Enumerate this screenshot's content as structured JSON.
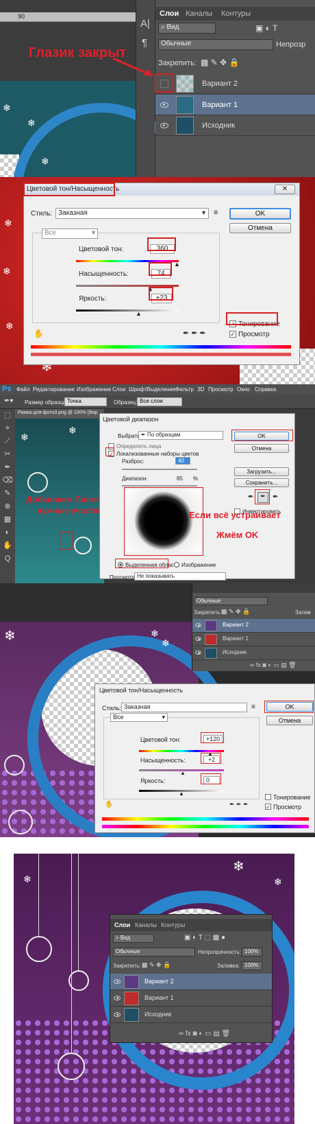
{
  "p1": {
    "ruler_num": "90",
    "tabs": [
      "Слои",
      "Каналы",
      "Контуры"
    ],
    "filter": "Вид",
    "blend": "Обычные",
    "opacity_label": "Непрозр",
    "lock_label": "Закрепить:",
    "layers": [
      "Вариант 2",
      "Вариант 1",
      "Исходник"
    ],
    "annotation": "Глазик закрыт"
  },
  "p2": {
    "title": "Цветовой тон/Насыщенность",
    "style_label": "Стиль:",
    "style_value": "Заказная",
    "channel": "Все",
    "hue_label": "Цветовой тон:",
    "hue_value": "360",
    "sat_label": "Насыщенность:",
    "sat_value": "74",
    "light_label": "Яркость:",
    "light_value": "+23",
    "ok": "OK",
    "cancel": "Отмена",
    "colorize": "Тонирование",
    "preview": "Просмотр"
  },
  "p3": {
    "menu": [
      "Файл",
      "Редактирование",
      "Изображение",
      "Слои",
      "Шрифт",
      "Выделение",
      "Фильтр",
      "3D",
      "Просмотр",
      "Окно",
      "Справка"
    ],
    "opt_size_label": "Размер образца:",
    "opt_size_value": "Точка",
    "opt_sample_label": "Образец:",
    "opt_sample_value": "Все слои",
    "doc_tab": "Рамка-для-фото3.png @ 100% (Вар",
    "dialog_title": "Цветовой диапазон",
    "select_label": "Выбрать:",
    "select_value": "По образцам",
    "faces": "Определять лица",
    "localized": "Локализованные наборы цветов",
    "fuzz_label": "Разброс:",
    "fuzz_value": "40",
    "range_label": "Диапазон:",
    "range_value": "85",
    "range_unit": "%",
    "radio_selection": "Выделенная область",
    "radio_image": "Изображение",
    "preview_label": "Просмотр:",
    "preview_value": "Не показывать",
    "ok": "OK",
    "cancel": "Отмена",
    "load": "Загрузить...",
    "save": "Сохранить...",
    "invert": "Инвертировать",
    "annot_left": "Добавляем Пипеткой нужные участки",
    "annot_right1": "Если всё устраивает",
    "annot_right2": "Жмём OK"
  },
  "p4": {
    "blend": "Обычные",
    "lock_label": "Закрепить:",
    "fill_label": "Залив",
    "layers": [
      "Вариант 2",
      "Вариант 1",
      "Исходник"
    ],
    "dialog_title": "Цветовой тон/Насыщенность",
    "style_label": "Стиль:",
    "style_value": "Заказная",
    "channel": "Все",
    "hue_label": "Цветовой тон:",
    "hue_value": "+120",
    "sat_label": "Насыщенность:",
    "sat_value": "+2",
    "light_label": "Яркость:",
    "light_value": "0",
    "ok": "OK",
    "cancel": "Отмена",
    "colorize": "Тонирование",
    "preview": "Просмотр"
  },
  "p5": {
    "tabs": [
      "Слои",
      "Каналы",
      "Контуры"
    ],
    "filter": "Вид",
    "blend": "Обычные",
    "opacity_label": "Непрозрачность:",
    "opacity_value": "100%",
    "lock_label": "Закрепить:",
    "fill_label": "Заливка:",
    "fill_value": "100%",
    "layers": [
      "Вариант 2",
      "Вариант 1",
      "Исходник"
    ]
  }
}
